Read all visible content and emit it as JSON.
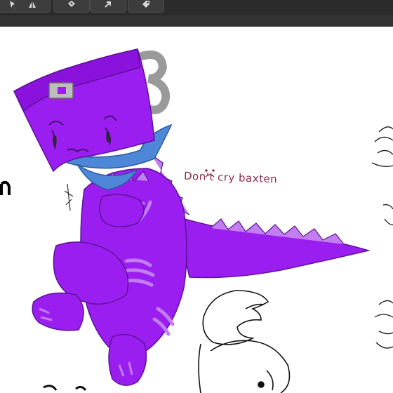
{
  "toolbar": {
    "buttons": [
      {
        "name": "tool-1",
        "icon": "cursor-icon"
      },
      {
        "name": "tool-2",
        "icon": "shape-icon"
      },
      {
        "name": "tool-3",
        "icon": "fill-icon"
      },
      {
        "name": "tool-4",
        "icon": "arrow-icon"
      },
      {
        "name": "tool-5",
        "icon": "tag-icon"
      }
    ]
  },
  "canvas": {
    "caption": "Don't cry baxten",
    "colors": {
      "body": "#9b1ef0",
      "body_dark": "#6a16b0",
      "stripe": "#c27df0",
      "bandana": "#4f87d8",
      "caption": "#8e2b4e"
    }
  }
}
